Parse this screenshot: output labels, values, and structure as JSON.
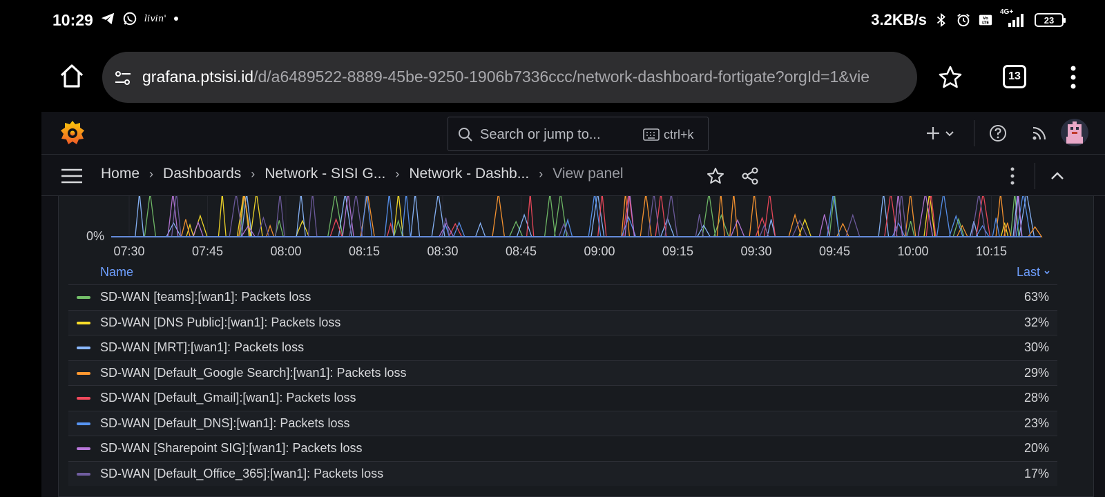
{
  "status_bar": {
    "time": "10:29",
    "left_icons": [
      "telegram-icon",
      "whatsapp-icon",
      "livin-icon",
      "dot-icon"
    ],
    "livin_label": "livin'",
    "net_speed": "3.2KB/s",
    "right_icons": [
      "bluetooth-icon",
      "alarm-icon",
      "volte-icon",
      "signal-icon"
    ],
    "network_type": "4G+",
    "battery": "23"
  },
  "browser": {
    "url_host": "grafana.ptsisi.id",
    "url_path": "/d/a6489522-8889-45be-9250-1906b7336ccc/network-dashboard-fortigate?orgId=1&vie",
    "tab_count": "13"
  },
  "grafana": {
    "search": {
      "placeholder": "Search or jump to...",
      "shortcut": "ctrl+k"
    },
    "breadcrumbs": [
      {
        "label": "Home"
      },
      {
        "label": "Dashboards"
      },
      {
        "label": "Network - SISI G..."
      },
      {
        "label": "Network - Dashb..."
      },
      {
        "label": "View panel"
      }
    ],
    "colors": {
      "background": "#111217",
      "panel": "#181b1f",
      "accent": "#6e9fff"
    }
  },
  "chart_data": {
    "type": "line",
    "y_visible_tick": "0%",
    "x_ticks": [
      "07:30",
      "07:45",
      "08:00",
      "08:15",
      "08:30",
      "08:45",
      "09:00",
      "09:15",
      "09:30",
      "09:45",
      "10:00",
      "10:15"
    ],
    "legend_header": {
      "name": "Name",
      "last": "Last"
    },
    "series": [
      {
        "name": "SD-WAN [teams]:[wan1]: Packets loss",
        "last": "63%",
        "color": "#73bf69"
      },
      {
        "name": "SD-WAN [DNS Public]:[wan1]: Packets loss",
        "last": "32%",
        "color": "#fade2a"
      },
      {
        "name": "SD-WAN [MRT]:[wan1]: Packets loss",
        "last": "30%",
        "color": "#8ab8ff"
      },
      {
        "name": "SD-WAN [Default_Google Search]:[wan1]: Packets loss",
        "last": "29%",
        "color": "#ff9830"
      },
      {
        "name": "SD-WAN [Default_Gmail]:[wan1]: Packets loss",
        "last": "28%",
        "color": "#f2495c"
      },
      {
        "name": "SD-WAN [Default_DNS]:[wan1]: Packets loss",
        "last": "23%",
        "color": "#5794f2"
      },
      {
        "name": "SD-WAN [Sharepoint SIG]:[wan1]: Packets loss",
        "last": "20%",
        "color": "#b877d9"
      },
      {
        "name": "SD-WAN [Default_Office_365]:[wan1]: Packets loss",
        "last": "17%",
        "color": "#705da0"
      }
    ]
  }
}
